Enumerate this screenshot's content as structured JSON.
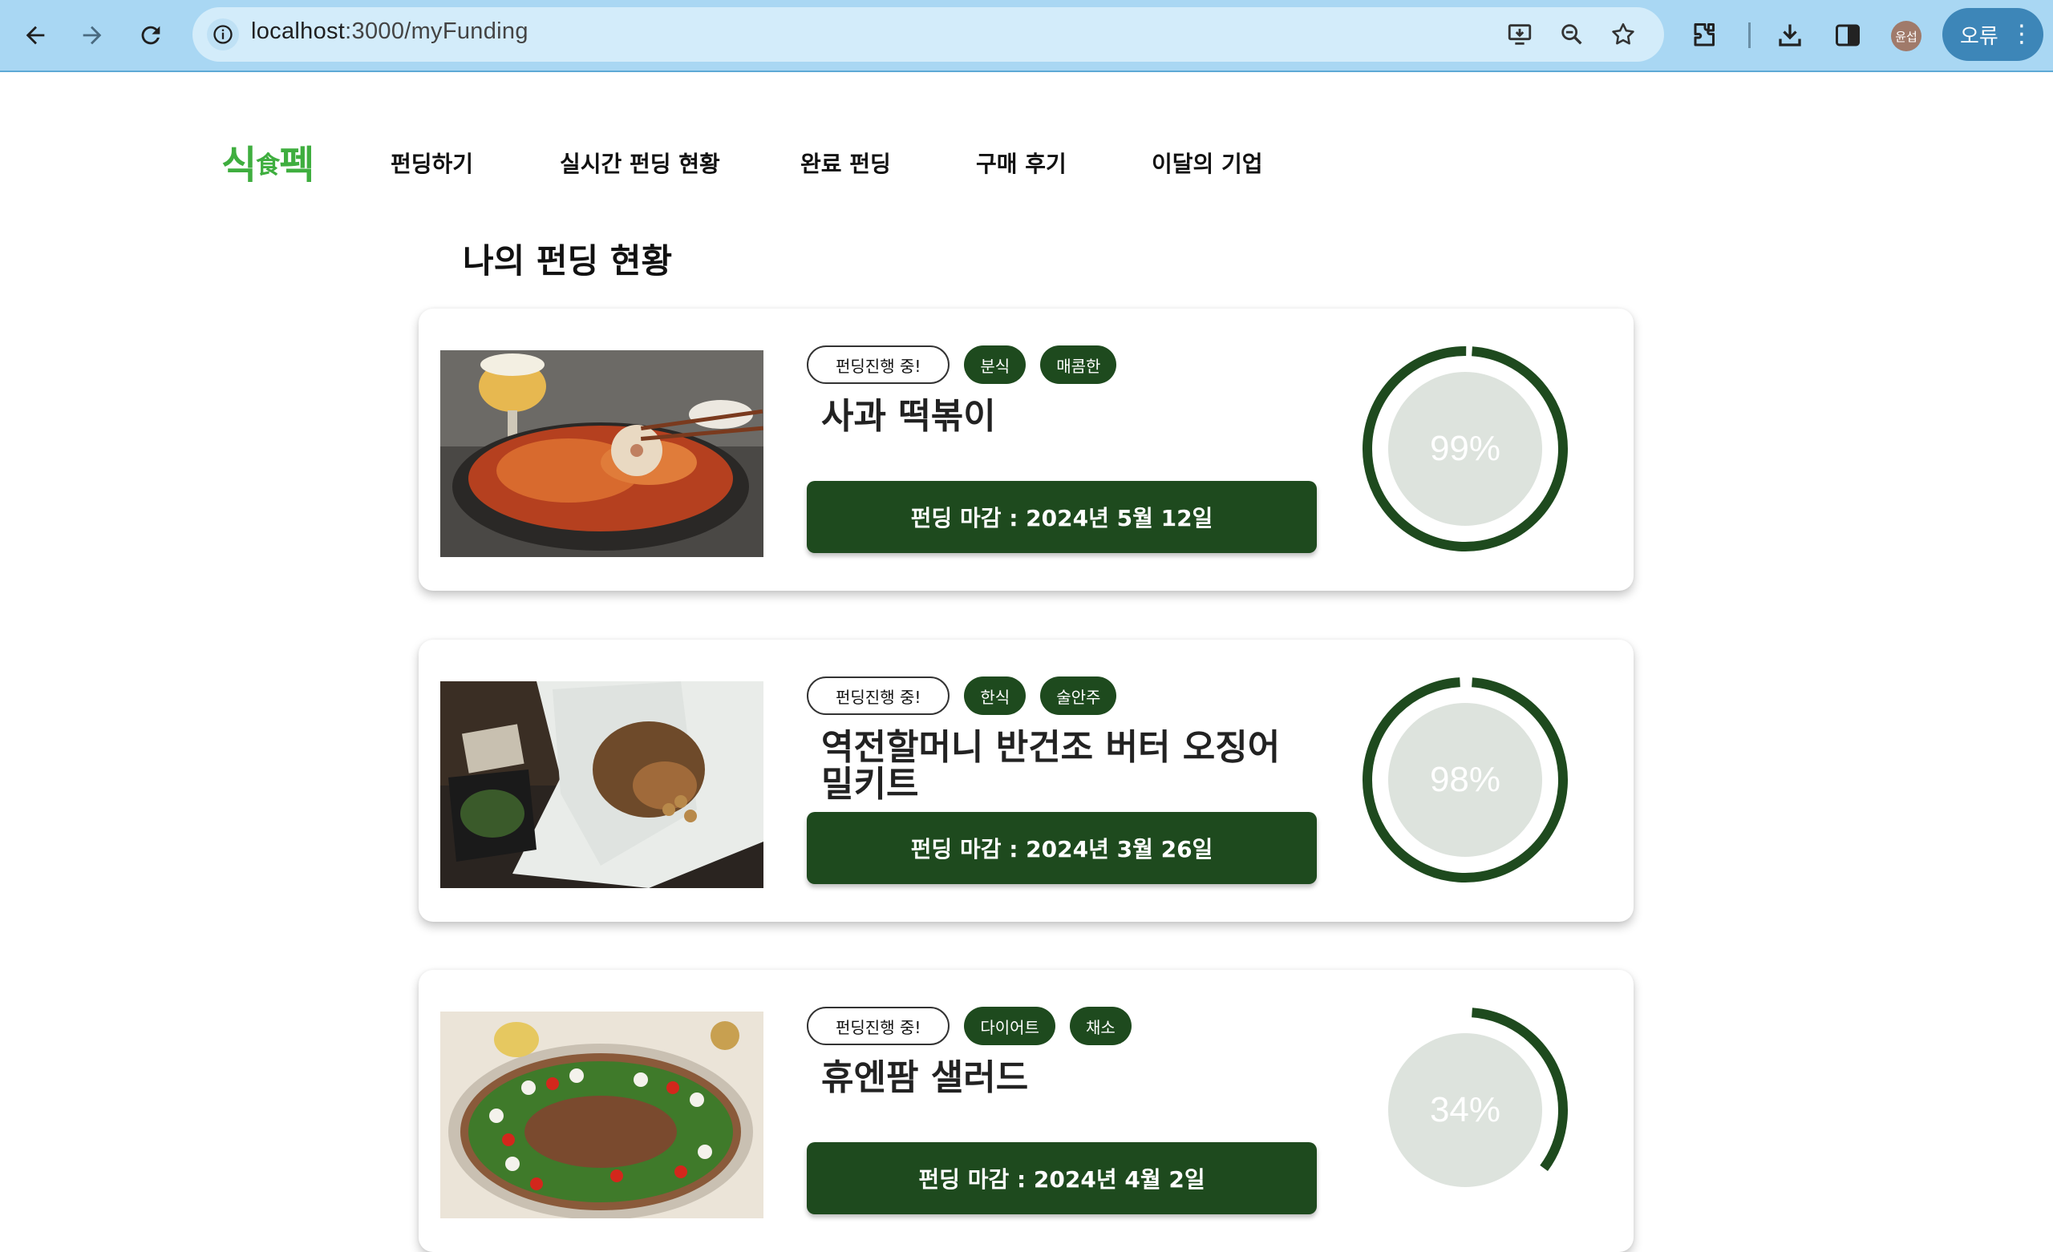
{
  "browser": {
    "url_host": "localhost",
    "url_path": ":3000/myFunding",
    "avatar_text": "윤섭",
    "profile_label": "오류",
    "profile_menu": "⋮",
    "accent": "#a9d7f3"
  },
  "header": {
    "logo_main_1": "식",
    "logo_small": "食",
    "logo_main_2": "펙",
    "logo_color": "#3fae3f",
    "menu": [
      "펀딩하기",
      "실시간 펀딩 현황",
      "완료 펀딩",
      "구매 후기",
      "이달의 기업"
    ]
  },
  "page": {
    "title": "나의 펀딩 현황"
  },
  "theme": {
    "primary": "#1e4a1e",
    "ring_bg": "#dde3dd"
  },
  "cards": [
    {
      "status": "펀딩진행 중!",
      "tags": [
        "분식",
        "매콤한"
      ],
      "title": "사과 떡볶이",
      "deadline": "펀딩 마감 : 2024년 5월 12일",
      "progress_label": "99%",
      "progress": 0.99
    },
    {
      "status": "펀딩진행 중!",
      "tags": [
        "한식",
        "술안주"
      ],
      "title": "역전할머니 반건조 버터 오징어 밀키트",
      "deadline": "펀딩 마감 : 2024년 3월 26일",
      "progress_label": "98%",
      "progress": 0.98
    },
    {
      "status": "펀딩진행 중!",
      "tags": [
        "다이어트",
        "채소"
      ],
      "title": "휴엔팜 샐러드",
      "deadline": "펀딩 마감 : 2024년 4월 2일",
      "progress_label": "34%",
      "progress": 0.34
    }
  ]
}
